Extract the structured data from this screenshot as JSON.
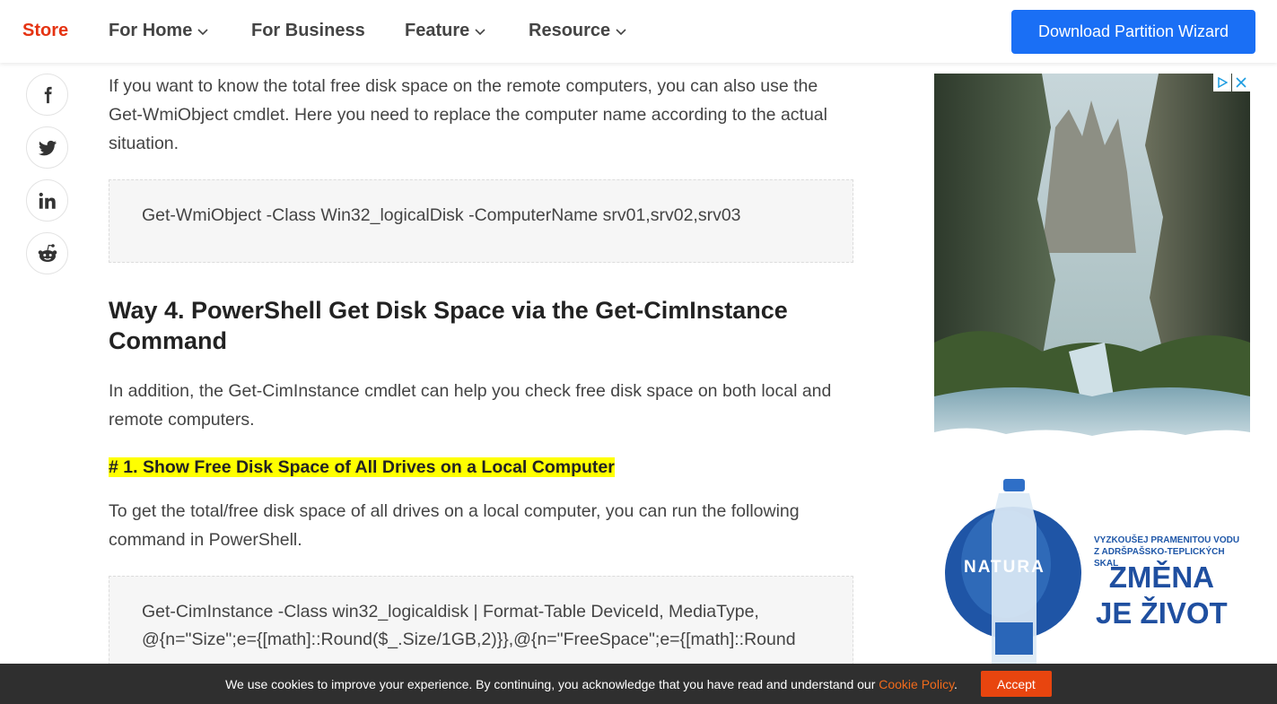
{
  "header": {
    "logo": "Store",
    "nav": [
      {
        "label": "For Home",
        "has_dropdown": true
      },
      {
        "label": "For Business",
        "has_dropdown": false
      },
      {
        "label": "Feature",
        "has_dropdown": true
      },
      {
        "label": "Resource",
        "has_dropdown": true
      }
    ],
    "cta": "Download Partition Wizard"
  },
  "social": [
    "facebook-icon",
    "twitter-icon",
    "linkedin-icon",
    "reddit-icon"
  ],
  "article": {
    "intro": "If you want to know the total free disk space on the remote computers, you can also use the Get-WmiObject cmdlet. Here you need to replace the computer name according to the actual situation.",
    "code1": "Get-WmiObject -Class Win32_logicalDisk -ComputerName srv01,srv02,srv03",
    "heading": "Way 4. PowerShell Get Disk Space via the Get-CimInstance Command",
    "para2": "In addition, the Get-CimInstance cmdlet can help you check free disk space on both local and remote computers.",
    "subheading": "# 1. Show Free Disk Space of All Drives on a Local Computer",
    "para3": "To get the total/free disk space of all drives on a local computer, you can run the following command in PowerShell.",
    "code2_line1": "Get-CimInstance -Class win32_logicaldisk | Format-Table DeviceId, MediaType,",
    "code2_line2": "@{n=\"Size\";e={[math]::Round($_.Size/1GB,2)}},@{n=\"FreeSpace\";e={[math]::Round"
  },
  "ad": {
    "headline_line1": "VYZKOUŠEJ PRAMENITOU VODU",
    "headline_line2": "Z ADRŠPAŠSKO-TEPLICKÝCH SKAL",
    "slogan_line1": "ZMĚNA",
    "slogan_line2": "JE ŽIVOT",
    "brand": "NATURA"
  },
  "cookie": {
    "text": "We use cookies to improve your experience. By continuing, you acknowledge that you have read and understand our",
    "link": "Cookie Policy",
    "period": ".",
    "accept": "Accept"
  },
  "colors": {
    "brand_red": "#e53312",
    "cta_blue": "#1a6ff5",
    "highlight": "#ffff00",
    "accept_orange": "#e8450f"
  }
}
